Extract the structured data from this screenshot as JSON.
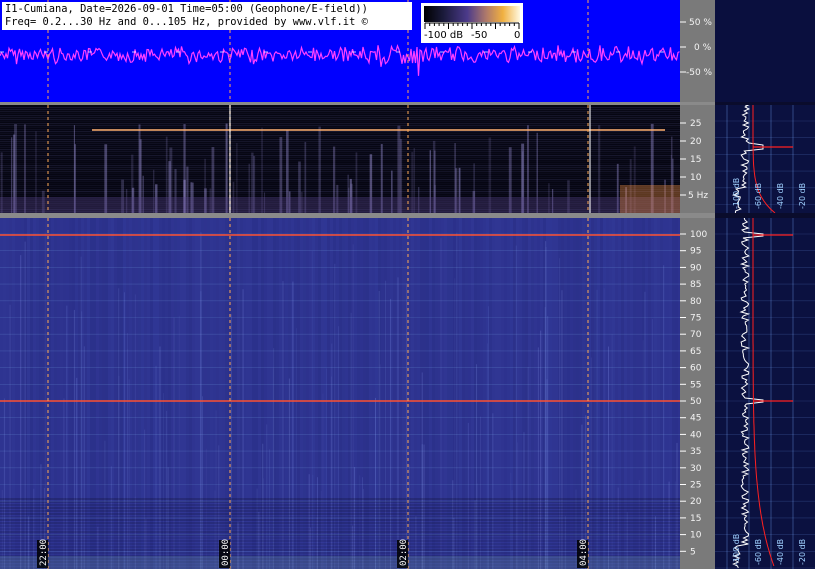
{
  "header": {
    "line1": "I1-Cumiana, Date=2026-09-01 Time=05:00 (Geophone/E-field))",
    "line2": "Freq= 0.2...30 Hz and 0...105 Hz, provided by www.vlf.it ©"
  },
  "colorbar": {
    "labels": [
      "-100 dB",
      "-50",
      "0"
    ]
  },
  "waveform": {
    "axis_labels": [
      "50 %",
      "0 %",
      "-50 %"
    ]
  },
  "low_spectrogram": {
    "axis_labels": [
      "25",
      "20",
      "15",
      "10",
      "5 Hz"
    ]
  },
  "main_spectrogram": {
    "axis_labels": [
      "100",
      "95",
      "90",
      "85",
      "80",
      "75",
      "70",
      "65",
      "60",
      "55",
      "50",
      "45",
      "40",
      "35",
      "30",
      "25",
      "20",
      "15",
      "10",
      "5"
    ]
  },
  "time_labels": [
    "22:00",
    "00:00",
    "02:00",
    "04:00"
  ],
  "side_panels": {
    "low_labels": [
      "-100 dB",
      "-60 dB",
      "-40 dB",
      "-20 dB"
    ],
    "main_labels": [
      "-100 dB",
      "-60 dB",
      "-40 dB",
      "-20 dB"
    ]
  },
  "colors": {
    "waveform_bg": "#0000ff",
    "waveform_trace": "#ff40ff",
    "main_spec_bg": "#2a2f88",
    "hum_line": "#ff5030",
    "marker_line": "#ffb070",
    "axis_bg": "#7a7a7a",
    "side_bg": "#0b1140",
    "profile": "#ffffff",
    "fit_curve": "#ff2020"
  }
}
